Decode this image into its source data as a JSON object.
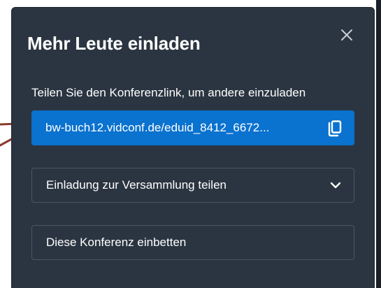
{
  "dialog": {
    "title": "Mehr Leute einladen",
    "close_icon": "close-icon",
    "share_label": "Teilen Sie den Konferenzlink, um andere einzuladen",
    "link": {
      "text": "bw-buch12.vidconf.de/eduid_8412_6672...",
      "icon": "copy-icon",
      "background": "#0a72cf"
    },
    "invite_select": {
      "label": "Einladung zur Versammlung teilen",
      "icon": "chevron-down-icon"
    },
    "embed": {
      "label": "Diese Konferenz einbetten"
    },
    "background": "#2b3541"
  },
  "annotation": {
    "color": "#c0392b",
    "icon": "arrow-pointer-icon"
  }
}
